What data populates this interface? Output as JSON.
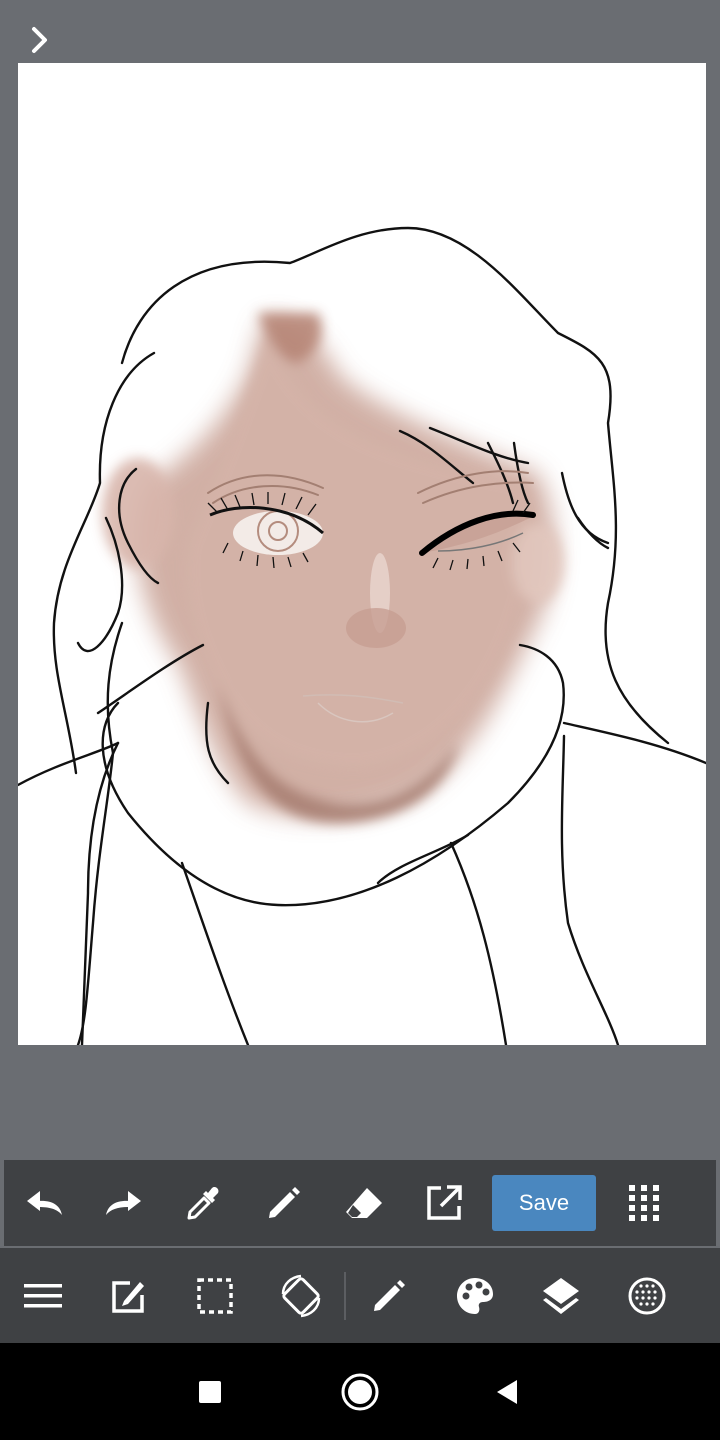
{
  "app": {
    "expand_icon": "chevron-right-icon"
  },
  "toolbar_top": {
    "items": [
      {
        "name": "undo",
        "icon": "undo-icon"
      },
      {
        "name": "redo",
        "icon": "redo-icon"
      },
      {
        "name": "eyedropper",
        "icon": "eyedropper-icon"
      },
      {
        "name": "pen",
        "icon": "pencil-icon"
      },
      {
        "name": "eraser",
        "icon": "eraser-icon"
      },
      {
        "name": "export",
        "icon": "external-link-icon"
      }
    ],
    "save_label": "Save",
    "more_icon": "grid-dots-icon"
  },
  "toolbar_bottom": {
    "items": [
      {
        "name": "menu",
        "icon": "hamburger-menu-icon"
      },
      {
        "name": "edit",
        "icon": "edit-icon"
      },
      {
        "name": "selection",
        "icon": "selection-icon"
      },
      {
        "name": "rotate-canvas",
        "icon": "screen-rotation-icon"
      },
      {
        "name": "brush",
        "icon": "pencil-icon"
      },
      {
        "name": "color",
        "icon": "palette-icon"
      },
      {
        "name": "layers",
        "icon": "layers-icon"
      },
      {
        "name": "material",
        "icon": "dotted-circle-icon"
      }
    ]
  },
  "colors": {
    "background": "#6a6d72",
    "toolbar": "#3f4144",
    "accent": "#4a87bf",
    "skin": "#c9a396"
  },
  "navbar": {
    "items": [
      "recent-apps-icon",
      "home-icon",
      "back-icon"
    ]
  }
}
